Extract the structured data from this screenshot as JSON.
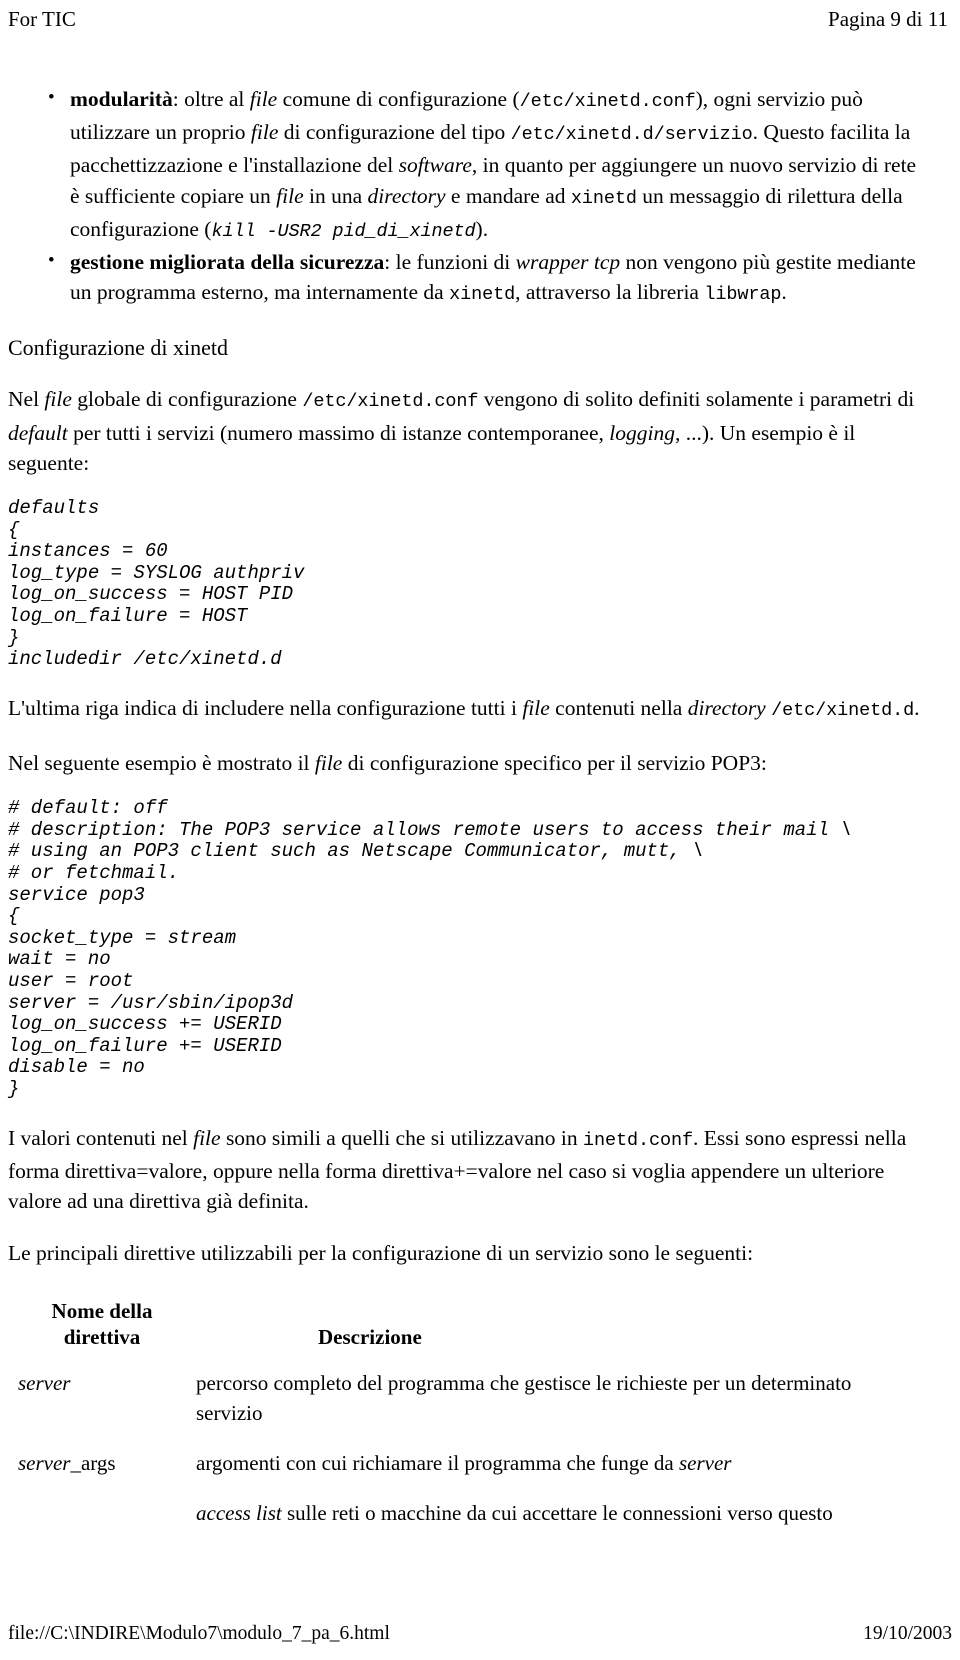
{
  "header": {
    "left": "For TIC",
    "right": "Pagina 9 di 11"
  },
  "bullets": [
    {
      "term": "modularità",
      "segments": [
        {
          "text": ": oltre al ",
          "style": "normal"
        },
        {
          "text": "file",
          "style": "italic"
        },
        {
          "text": " comune di configurazione (",
          "style": "normal"
        },
        {
          "text": "/etc/xinetd.conf",
          "style": "mono"
        },
        {
          "text": "), ogni servizio può utilizzare un proprio ",
          "style": "normal"
        },
        {
          "text": "file",
          "style": "italic"
        },
        {
          "text": " di configurazione del tipo ",
          "style": "normal"
        },
        {
          "text": "/etc/xinetd.d/servizio",
          "style": "mono"
        },
        {
          "text": ". Questo facilita la pacchettizzazione e l'installazione del ",
          "style": "normal"
        },
        {
          "text": "software",
          "style": "italic"
        },
        {
          "text": ", in quanto per aggiungere un nuovo servizio di rete è sufficiente copiare un ",
          "style": "normal"
        },
        {
          "text": "file",
          "style": "italic"
        },
        {
          "text": " in una ",
          "style": "normal"
        },
        {
          "text": "directory",
          "style": "italic"
        },
        {
          "text": " e mandare ad ",
          "style": "normal"
        },
        {
          "text": "xinetd",
          "style": "mono"
        },
        {
          "text": " un messaggio di rilettura della configurazione (",
          "style": "normal"
        },
        {
          "text": "kill -USR2 pid_di_xinetd",
          "style": "mono-italic"
        },
        {
          "text": ").",
          "style": "normal"
        }
      ]
    },
    {
      "term": "gestione migliorata della sicurezza",
      "segments": [
        {
          "text": ": le funzioni di ",
          "style": "normal"
        },
        {
          "text": "wrapper tcp",
          "style": "italic"
        },
        {
          "text": " non vengono più gestite mediante un programma esterno, ma internamente da ",
          "style": "normal"
        },
        {
          "text": "xinetd",
          "style": "mono"
        },
        {
          "text": ", attraverso la libreria ",
          "style": "normal"
        },
        {
          "text": "libwrap",
          "style": "mono"
        },
        {
          "text": ".",
          "style": "normal"
        }
      ]
    }
  ],
  "section_heading": "Configurazione di xinetd",
  "paragraph_intro": {
    "segments": [
      {
        "text": "Nel ",
        "style": "normal"
      },
      {
        "text": "file",
        "style": "italic"
      },
      {
        "text": " globale di configurazione ",
        "style": "normal"
      },
      {
        "text": "/etc/xinetd.conf",
        "style": "mono"
      },
      {
        "text": " vengono di solito definiti solamente i parametri di ",
        "style": "normal"
      },
      {
        "text": "default",
        "style": "italic"
      },
      {
        "text": " per tutti i servizi (numero massimo di istanze contemporanee, ",
        "style": "normal"
      },
      {
        "text": "logging",
        "style": "italic"
      },
      {
        "text": ", ...). Un esempio è il seguente:",
        "style": "normal"
      }
    ]
  },
  "code_defaults": "defaults\n{\ninstances = 60\nlog_type = SYSLOG authpriv\nlog_on_success = HOST PID\nlog_on_failure = HOST\n}\nincludedir /etc/xinetd.d",
  "paragraph_includedir": {
    "segments": [
      {
        "text": "L'ultima riga indica di includere nella configurazione tutti i ",
        "style": "normal"
      },
      {
        "text": "file",
        "style": "italic"
      },
      {
        "text": " contenuti nella ",
        "style": "normal"
      },
      {
        "text": "directory",
        "style": "italic"
      },
      {
        "text": " ",
        "style": "normal"
      },
      {
        "text": "/etc/xinetd.d",
        "style": "mono"
      },
      {
        "text": ".",
        "style": "normal"
      }
    ]
  },
  "paragraph_pop3": {
    "segments": [
      {
        "text": "Nel seguente esempio è mostrato il ",
        "style": "normal"
      },
      {
        "text": "file",
        "style": "italic"
      },
      {
        "text": " di configurazione specifico per il servizio POP3:",
        "style": "normal"
      }
    ]
  },
  "code_pop3": "# default: off\n# description: The POP3 service allows remote users to access their mail \\\n# using an POP3 client such as Netscape Communicator, mutt, \\\n# or fetchmail.\nservice pop3\n{\nsocket_type = stream\nwait = no\nuser = root\nserver = /usr/sbin/ipop3d\nlog_on_success += USERID\nlog_on_failure += USERID\ndisable = no\n}",
  "paragraph_valori": {
    "segments": [
      {
        "text": "I valori contenuti nel ",
        "style": "normal"
      },
      {
        "text": "file",
        "style": "italic"
      },
      {
        "text": " sono simili a quelli che si utilizzavano in ",
        "style": "normal"
      },
      {
        "text": "inetd.conf",
        "style": "mono"
      },
      {
        "text": ". Essi sono espressi nella forma direttiva=valore, oppure nella forma direttiva+=valore nel caso si voglia appendere un ulteriore valore ad una direttiva già definita.",
        "style": "normal"
      }
    ]
  },
  "paragraph_direttive": {
    "segments": [
      {
        "text": "Le principali direttive utilizzabili per la configurazione di un servizio sono le seguenti:",
        "style": "normal"
      }
    ]
  },
  "table": {
    "headers": {
      "name": "Nome della direttiva",
      "name_line1": "Nome della",
      "name_line2": "direttiva",
      "description": "Descrizione"
    },
    "rows": [
      {
        "name_segments": [
          {
            "text": "server",
            "style": "italic"
          }
        ],
        "desc_segments": [
          {
            "text": "percorso completo del programma che gestisce le richieste per un determinato servizio",
            "style": "normal"
          }
        ]
      },
      {
        "name_segments": [
          {
            "text": "server",
            "style": "italic"
          },
          {
            "text": "_args",
            "style": "normal"
          }
        ],
        "desc_segments": [
          {
            "text": "argomenti con cui richiamare il programma che funge da ",
            "style": "normal"
          },
          {
            "text": "server",
            "style": "italic"
          }
        ]
      },
      {
        "name_segments": [],
        "desc_segments": [
          {
            "text": "access list",
            "style": "italic"
          },
          {
            "text": " sulle reti o macchine da cui accettare le connessioni verso questo",
            "style": "normal"
          }
        ]
      }
    ]
  },
  "footer": {
    "left": "file://C:\\INDIRE\\Modulo7\\modulo_7_pa_6.html",
    "right": "19/10/2003"
  }
}
